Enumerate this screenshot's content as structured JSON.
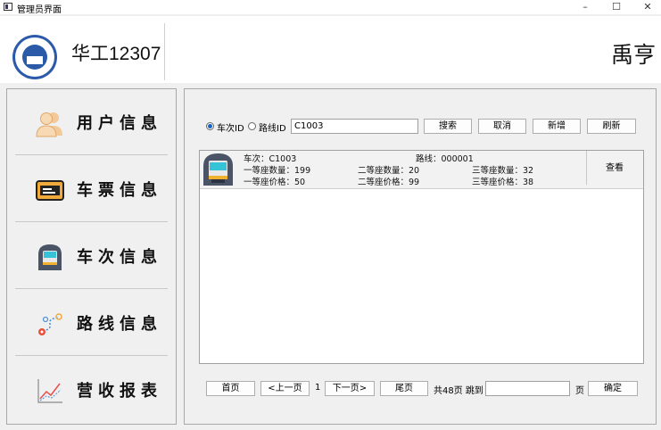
{
  "window": {
    "title": "管理员界面",
    "minimize": "–",
    "maximize": "☐",
    "close": "✕"
  },
  "header": {
    "brand": "华工12307",
    "username": "禹亨"
  },
  "sidebar": {
    "items": [
      {
        "label": "用户信息",
        "icon": "users-icon"
      },
      {
        "label": "车票信息",
        "icon": "ticket-icon"
      },
      {
        "label": "车次信息",
        "icon": "train-icon"
      },
      {
        "label": "路线信息",
        "icon": "route-icon"
      },
      {
        "label": "营收报表",
        "icon": "chart-icon"
      }
    ]
  },
  "search": {
    "option_train": "车次ID",
    "option_route": "路线ID",
    "selected": "车次ID",
    "value": "C1003",
    "search_label": "搜索",
    "cancel_label": "取消",
    "add_label": "新增",
    "refresh_label": "刷新"
  },
  "record": {
    "train": "车次：C1003",
    "route": "路线：000001",
    "first_count": "一等座数量：199",
    "second_count": "二等座数量：20",
    "third_count": "三等座数量：32",
    "first_price": "一等座价格：50",
    "second_price": "二等座价格：99",
    "third_price": "三等座价格：38",
    "view_label": "查看"
  },
  "pager": {
    "first": "首页",
    "prev": "<上一页",
    "current": "1",
    "next": "下一页>",
    "last": "尾页",
    "total": "共48页 跳到",
    "page_suffix": "页",
    "confirm": "确定"
  },
  "colors": {
    "accent": "#1464c8",
    "logo": "#2a5aa8"
  }
}
